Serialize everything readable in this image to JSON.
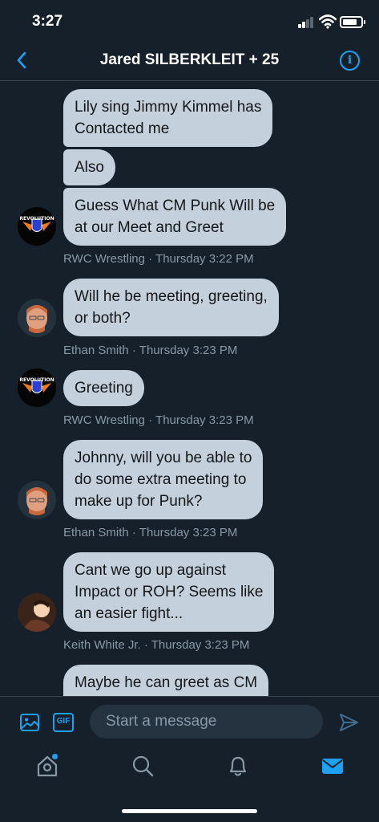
{
  "status_bar": {
    "time": "3:27"
  },
  "header": {
    "title": "Jared SILBERKLEIT + 25"
  },
  "messages": [
    {
      "text": "Lily sing Jimmy Kimmel has\nContacted me"
    },
    {
      "text": "Also"
    },
    {
      "text": "Guess What CM Punk Will be\nat our Meet and Greet"
    },
    {
      "text": "Will he be meeting, greeting,\nor both?"
    },
    {
      "text": "Greeting"
    },
    {
      "text": "Johnny, will you be able to\ndo some extra meeting to\nmake up for Punk?"
    },
    {
      "text": "Cant we go up against\nImpact or ROH? Seems like\nan easier fight..."
    },
    {
      "text": "Maybe he can greet as CM"
    }
  ],
  "meta": [
    {
      "sender": "RWC Wrestling",
      "time": "· Thursday 3:22 PM"
    },
    {
      "sender": "Ethan Smith",
      "time": "· Thursday 3:23 PM"
    },
    {
      "sender": "RWC Wrestling",
      "time": "· Thursday 3:23 PM"
    },
    {
      "sender": "Ethan Smith",
      "time": "· Thursday 3:23 PM"
    },
    {
      "sender": "Keith White Jr.",
      "time": "· Thursday 3:23 PM"
    }
  ],
  "avatars": {
    "rwc_logo_text": "REVOLUTION"
  },
  "composer": {
    "placeholder": "Start a message",
    "gif_label": "GIF"
  },
  "icons": {
    "back": "chevron-left-icon",
    "info": "info-icon",
    "image": "image-icon",
    "send": "send-icon",
    "tabs": [
      "home-icon",
      "search-icon",
      "bell-icon",
      "mail-icon"
    ]
  },
  "colors": {
    "accent": "#1da1f2",
    "background": "#15202b",
    "bubble": "#c4d0db",
    "meta_text": "#8899a6"
  }
}
